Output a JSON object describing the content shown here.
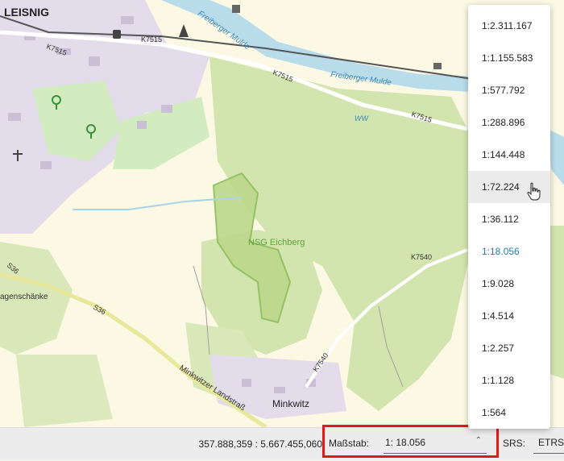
{
  "map": {
    "labels": {
      "town_leisnig": "LEISNIG",
      "road_k7515_a": "K7515",
      "road_k7515_b": "K7515",
      "road_k7515_c": "K7515",
      "road_k7515_d": "K7515",
      "river_1": "Freiberger Mulde",
      "river_2": "Freiberger Mulde",
      "ww": "WW",
      "nsg": "NSG Eichberg",
      "road_k7540_a": "K7540",
      "road_k7540_b": "K7540",
      "road_s36_a": "S36",
      "road_s36_b": "S36",
      "place_agenschaenke": "agenschänke",
      "street_minkwitzer": "Minkwitzer Landstraß",
      "village_minkwitz": "Minkwitz"
    },
    "colors": {
      "forest": "#cfe3a8",
      "field": "#fbf8e3",
      "water": "#b8dcea",
      "urban": "#e3dcea"
    },
    "icons": [
      "train-icon",
      "tower-icon",
      "tree-icon",
      "church-icon",
      "building-icon"
    ]
  },
  "statusbar": {
    "coordinates": "357.888,359 : 5.667.455,060",
    "scale_label": "Maßstab:",
    "scale_value": "1: 18.056",
    "srs_label": "SRS:",
    "srs_value": "ETRS"
  },
  "scale_dropdown": {
    "options": [
      "1:2.311.167",
      "1:1.155.583",
      "1:577.792",
      "1:288.896",
      "1:144.448",
      "1:72.224",
      "1:36.112",
      "1:18.056",
      "1:9.028",
      "1:4.514",
      "1:2.257",
      "1:1.128",
      "1:564"
    ],
    "hovered_index": 5,
    "selected_index": 7,
    "selected_color": "#1f7fae"
  }
}
